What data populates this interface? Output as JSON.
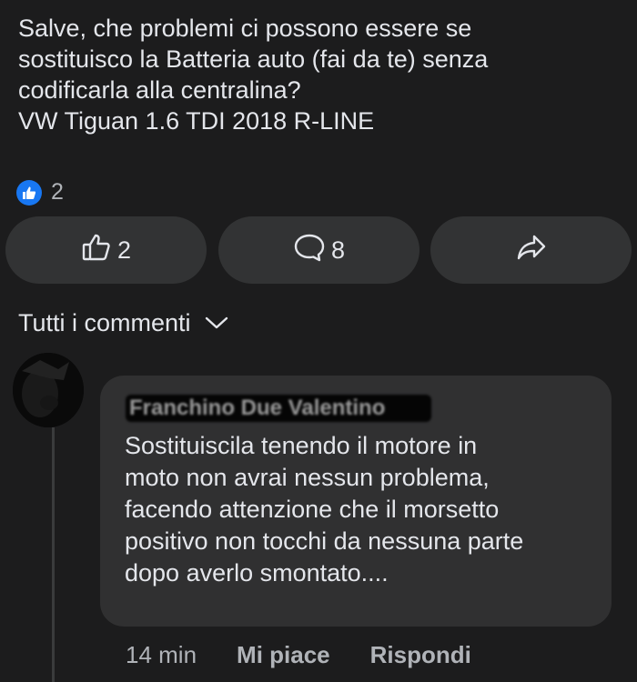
{
  "post": {
    "lines": [
      "Salve, che problemi ci possono essere se",
      "sostituisco la  Batteria auto (fai da te) senza",
      "codificarla alla centralina?",
      "VW Tiguan 1.6 TDI 2018 R-LINE"
    ],
    "reaction_count": "2"
  },
  "actions": {
    "like_count": "2",
    "comment_count": "8"
  },
  "comments_filter": {
    "label": "Tutti i commenti"
  },
  "comment": {
    "author": "Franchino Due Valentino",
    "lines": [
      "Sostituiscila tenendo il motore in",
      "moto non avrai nessun problema,",
      "facendo attenzione che il morsetto",
      "positivo non tocchi da nessuna parte",
      "dopo averlo smontato...."
    ],
    "time": "14 min",
    "like_label": "Mi piace",
    "reply_label": "Rispondi"
  },
  "colors": {
    "background": "#1c1c1d",
    "like_badge": "#1877f2",
    "button_bg": "#323334",
    "bubble_bg": "#303031"
  },
  "icons": [
    "like-badge-icon",
    "thumbs-up-icon",
    "comment-icon",
    "share-icon",
    "chevron-down-icon"
  ]
}
